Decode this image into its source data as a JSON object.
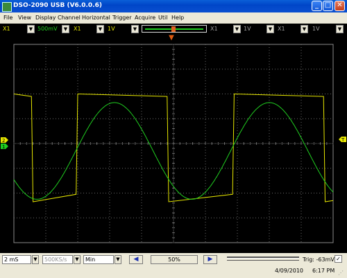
{
  "window": {
    "title": "DSO-2090 USB (V6.0.0.6)",
    "minimize": "_",
    "maximize": "□",
    "close": "✕"
  },
  "menu": [
    "File",
    "View",
    "Display",
    "Channel",
    "Horizontal",
    "Trigger",
    "Acquire",
    "Util",
    "Help"
  ],
  "toolbar": {
    "ch1_probe": "X1",
    "ch1_volts": "500mV",
    "ch2_probe": "X1",
    "ch2_volts": "1V",
    "ch3_probe": "X1",
    "ch3_volts": "1V",
    "ch4_probe": "X1",
    "ch4_volts": "1V",
    "dropdown_glyph": "▼",
    "trigger_position_marker": "▼"
  },
  "markers": {
    "channel_left_top": "2",
    "channel_left_bottom": "1",
    "trigger_right": "T"
  },
  "status": {
    "timebase": "2 mS",
    "sample_rate": "500KS/s",
    "mode": "Min",
    "prev_arrow": "◀",
    "position_pct": "50%",
    "next_arrow": "▶",
    "trigger_level": "Trig: -63mV",
    "check": "✓",
    "date": "4/09/2010",
    "time": "6:17 PM"
  },
  "colors": {
    "ch1": "#e8e800",
    "ch2": "#20d020",
    "grid": "#6a6a6a",
    "background": "#000000"
  },
  "chart_data": {
    "type": "line",
    "grid": true,
    "divisions": {
      "x": 10,
      "y": 8
    },
    "x_range_div": [
      0,
      10
    ],
    "y_range_div": [
      -4,
      4
    ],
    "series": [
      {
        "channel": 1,
        "color": "#e8e800",
        "shape": "square",
        "points": [
          [
            0,
            2.0
          ],
          [
            0.55,
            1.9
          ],
          [
            0.6,
            -2.35
          ],
          [
            1.95,
            -2.05
          ],
          [
            2.0,
            2.0
          ],
          [
            4.8,
            1.9
          ],
          [
            4.85,
            -2.35
          ],
          [
            6.85,
            -2.05
          ],
          [
            6.9,
            2.0
          ],
          [
            9.7,
            1.9
          ],
          [
            9.75,
            -2.35
          ],
          [
            10.0,
            -2.3
          ]
        ]
      },
      {
        "channel": 2,
        "color": "#20d020",
        "shape": "sine",
        "amplitude_div": 1.95,
        "center_div": -0.3,
        "period_div": 4.85,
        "phase_peak_div": 3.15
      }
    ]
  }
}
